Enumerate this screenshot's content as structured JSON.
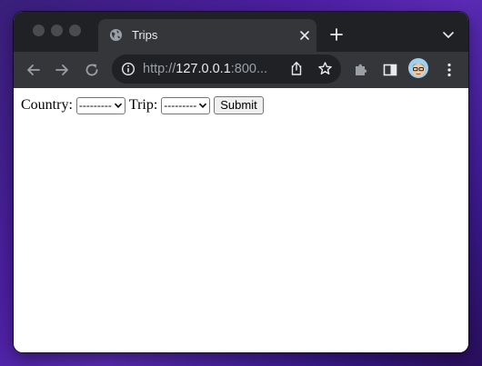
{
  "browser": {
    "tab_title": "Trips",
    "url_prefix": "http://",
    "url_host": "127.0.0.1",
    "url_rest": ":800..."
  },
  "form": {
    "country_label": "Country:",
    "country_selected": "---------",
    "trip_label": "Trip:",
    "trip_selected": "---------",
    "submit_label": "Submit"
  },
  "colors": {
    "desktop_background": "#4b1fa0",
    "tab_strip": "#202124",
    "toolbar": "#35363a"
  }
}
